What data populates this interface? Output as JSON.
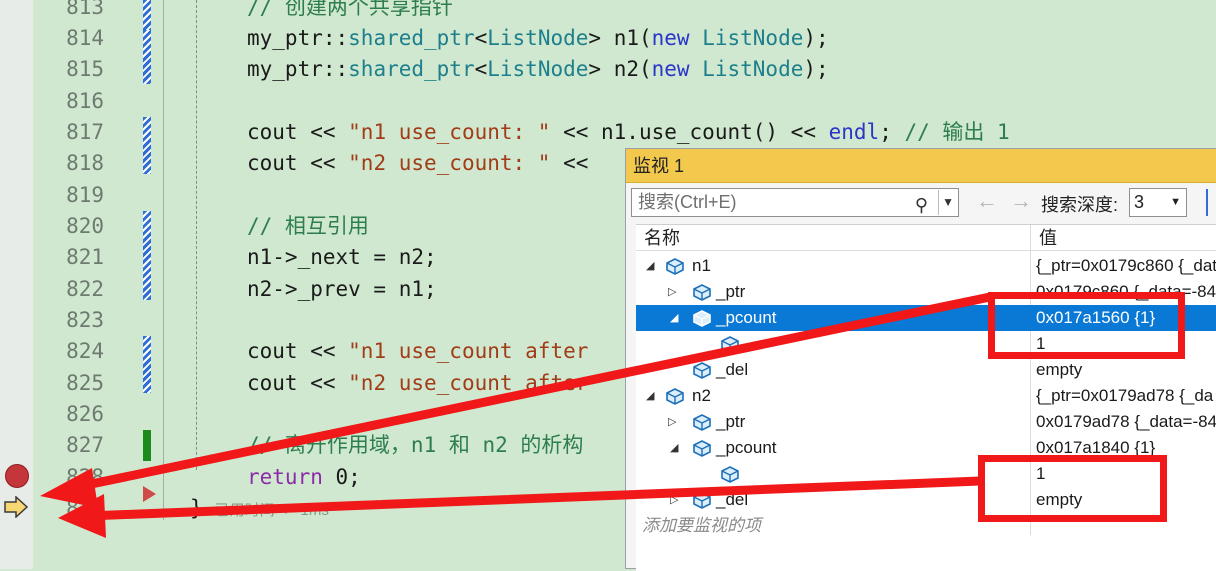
{
  "editor": {
    "line_numbers": [
      "813",
      "814",
      "815",
      "816",
      "817",
      "818",
      "819",
      "820",
      "821",
      "822",
      "823",
      "824",
      "825",
      "826",
      "827",
      "828",
      "829"
    ],
    "code": {
      "l813": "// 创建两个共享指针",
      "l814": [
        "my_ptr::",
        "shared_ptr",
        "<",
        "ListNode",
        "> n1(",
        "new",
        " ",
        "ListNode",
        ");"
      ],
      "l815": [
        "my_ptr::",
        "shared_ptr",
        "<",
        "ListNode",
        "> n2(",
        "new",
        " ",
        "ListNode",
        ");"
      ],
      "l817": [
        "cout << ",
        "\"n1 use_count: \"",
        " << n1.use_count() << ",
        "endl",
        "; ",
        "// 输出 1"
      ],
      "l818": [
        "cout << ",
        "\"n2 use_count: \"",
        " <<"
      ],
      "l820": "// 相互引用",
      "l821": "n1->_next = n2;",
      "l822": "n2->_prev = n1;",
      "l824": [
        "cout << ",
        "\"n1 use_count after"
      ],
      "l825": [
        "cout << ",
        "\"n2 use_count after"
      ],
      "l827": "// 离开作用域，n1 和 n2 的析构",
      "l828": [
        "return",
        " 0;"
      ],
      "l829": "}",
      "l829_hint": "已用时间 <= 1ms"
    }
  },
  "watch": {
    "title": "监视 1",
    "search_placeholder": "搜索(Ctrl+E)",
    "search_icon": "magnifier-icon",
    "nav_back": "←",
    "nav_forward": "→",
    "depth_label": "搜索深度:",
    "depth_value": "3",
    "columns": {
      "name": "名称",
      "value": "值"
    },
    "rows": [
      {
        "name": "n1",
        "value": "{_ptr=0x0179c860 {_data"
      },
      {
        "name": "_ptr",
        "value": "0x0179c860 {_data=-84"
      },
      {
        "name": "_pcount",
        "value": "0x017a1560 {1}"
      },
      {
        "name": "",
        "value": "1"
      },
      {
        "name": "_del",
        "value": "empty"
      },
      {
        "name": "n2",
        "value": "{_ptr=0x0179ad78 {_da"
      },
      {
        "name": "_ptr",
        "value": "0x0179ad78 {_data=-84"
      },
      {
        "name": "_pcount",
        "value": "0x017a1840 {1}"
      },
      {
        "name": "",
        "value": "1"
      },
      {
        "name": "_del",
        "value": "empty"
      }
    ],
    "add_watch": "添加要监视的项"
  },
  "colors": {
    "accent": "#0a79d6",
    "title_bar": "#f2c94c",
    "annotation": "#f01818",
    "editor_bg": "#cfe8cf"
  }
}
